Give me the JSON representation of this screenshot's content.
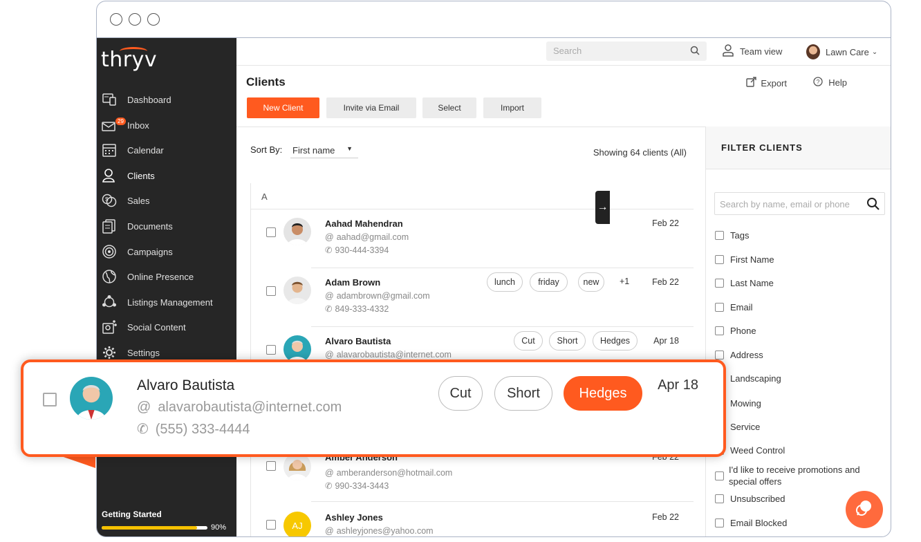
{
  "brand": {
    "logo": "thryv",
    "accent": "#ff5a1f"
  },
  "sidebar": {
    "items": [
      {
        "label": "Dashboard",
        "icon": "dashboard-icon"
      },
      {
        "label": "Inbox",
        "icon": "inbox-icon",
        "badge": "29"
      },
      {
        "label": "Calendar",
        "icon": "calendar-icon"
      },
      {
        "label": "Clients",
        "icon": "clients-icon"
      },
      {
        "label": "Sales",
        "icon": "sales-icon"
      },
      {
        "label": "Documents",
        "icon": "documents-icon"
      },
      {
        "label": "Campaigns",
        "icon": "campaigns-icon"
      },
      {
        "label": "Online Presence",
        "icon": "globe-icon"
      },
      {
        "label": "Listings Management",
        "icon": "listings-icon"
      },
      {
        "label": "Social Content",
        "icon": "social-icon"
      },
      {
        "label": "Settings",
        "icon": "gear-icon"
      }
    ],
    "getting_started": {
      "label": "Getting Started",
      "percent": "90%",
      "progress": 0.9
    }
  },
  "topbar": {
    "search_placeholder": "Search",
    "team_view": "Team view",
    "account": "Lawn Care"
  },
  "page": {
    "title": "Clients",
    "export": "Export",
    "help": "Help",
    "buttons": {
      "new_client": "New Client",
      "invite": "Invite via Email",
      "select": "Select",
      "import": "Import"
    },
    "sort_label": "Sort By:",
    "sort_value": "First name",
    "showing": "Showing 64 clients (All)",
    "group_letter": "A"
  },
  "clients": [
    {
      "name": "Aahad Mahendran",
      "email": "aahad@gmail.com",
      "phone": "930-444-3394",
      "date": "Feb 22",
      "tags": []
    },
    {
      "name": "Adam Brown",
      "email": "adambrown@gmail.com",
      "phone": "849-333-4332",
      "date": "Feb 22",
      "tags": [
        "lunch",
        "friday",
        "new"
      ],
      "more": "+1"
    },
    {
      "name": "Alvaro Bautista",
      "email": "alavarobautista@internet.com",
      "phone": "",
      "date": "Apr 18",
      "tags": [
        "Cut",
        "Short",
        "Hedges"
      ]
    },
    {
      "name": "Amber Anderson",
      "email": "amberanderson@hotmail.com",
      "phone": "990-334-3443",
      "date": "Feb 22",
      "tags": []
    },
    {
      "name": "Ashley Jones",
      "email": "ashleyjones@yahoo.com",
      "phone": "",
      "date": "Feb 22",
      "tags": [],
      "initials": "AJ"
    }
  ],
  "filter": {
    "title": "FILTER CLIENTS",
    "search_placeholder": "Search by name, email or phone",
    "options": [
      "Tags",
      "First Name",
      "Last Name",
      "Email",
      "Phone",
      "Address",
      "Landscaping",
      "Mowing",
      "Service",
      "Weed Control",
      "I'd like to receive promotions and special offers",
      "Unsubscribed",
      "Email Blocked"
    ]
  },
  "callout": {
    "name": "Alvaro Bautista",
    "email": "alavarobautista@internet.com",
    "phone": "(555) 333-4444",
    "date": "Apr 18",
    "tags": [
      "Cut",
      "Short",
      "Hedges"
    ],
    "highlighted_tag": "Hedges"
  }
}
